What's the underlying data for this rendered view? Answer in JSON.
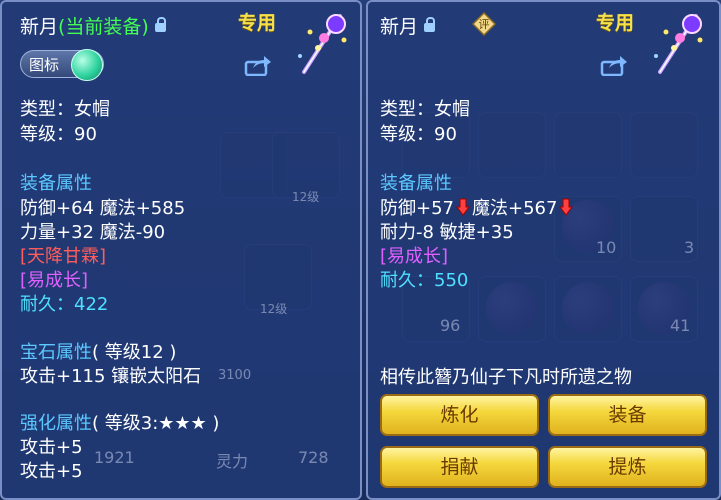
{
  "left_panel": {
    "title_name": "新月",
    "title_status": "(当前装备)",
    "exclusive": "专用",
    "toggle_label": "图标",
    "lines": {
      "type": "类型：女帽",
      "level": "等级：90",
      "equip_attr_header": "装备属性",
      "attr1": "防御+64 魔法+585",
      "attr2": "力量+32 魔法-90",
      "effect1": "[天降甘霖]",
      "effect2": "[易成长]",
      "durability_label": "耐久：",
      "durability_value": "422",
      "gem_header": "宝石属性",
      "gem_level": "( 等级12 )",
      "gem_attr": "攻击+115 镶嵌太阳石",
      "enhance_header": "强化属性",
      "enhance_level": "( 等级3:★★★ )",
      "enhance_1": "攻击+5",
      "enhance_2": "攻击+5"
    }
  },
  "right_panel": {
    "title_name": "新月",
    "eval_badge": "评",
    "exclusive": "专用",
    "lines": {
      "type": "类型：女帽",
      "level": "等级：90",
      "equip_attr_header": "装备属性",
      "attr1a": "防御+57",
      "attr1b": "魔法+567",
      "attr2": "耐力-8 敏捷+35",
      "effect1": "[易成长]",
      "durability_label": "耐久：",
      "durability_value": "550",
      "description": "相传此簪乃仙子下凡时所遗之物"
    },
    "buttons": {
      "refine": "炼化",
      "equip": "装备",
      "donate": "捐献",
      "extract": "提炼"
    }
  },
  "background_text": {
    "n10": "10",
    "n3": "3",
    "n96": "96",
    "n41": "41",
    "n12a": "12级",
    "n12b": "12级",
    "n1921": "1921",
    "lingli": "灵力",
    "n728": "728",
    "n3100": "3100"
  },
  "colors": {
    "current_equip": "#42ff52",
    "section_header": "#5cc8ff",
    "special_effect": "#ff5c5c",
    "growth": "#e060ff",
    "durability": "#4fe0ff",
    "exclusive": "#f7e14a"
  }
}
